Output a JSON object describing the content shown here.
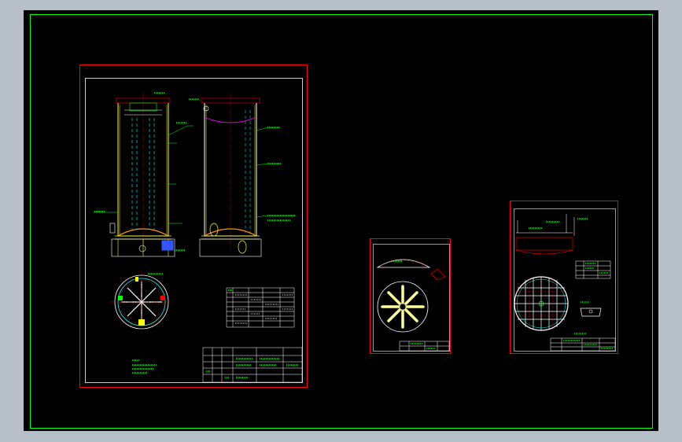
{
  "colors": {
    "background": "#000000",
    "window_border": "#00ff00",
    "sheet_border": "#ff0000",
    "frame": "#ffffff",
    "vessel": "#ffff00",
    "dims": "#00ff00",
    "hidden": "#00ffff",
    "accent": "#ff00ff",
    "blue": "#3355ff",
    "orange": "#ff9900"
  },
  "sheets": [
    {
      "id": "sheet-main-assembly",
      "title": "tank-assembly-drawing"
    },
    {
      "id": "sheet-distributor-plate",
      "title": "distributor-detail-drawing"
    },
    {
      "id": "sheet-support-grid",
      "title": "support-grid-detail-drawing"
    }
  ]
}
